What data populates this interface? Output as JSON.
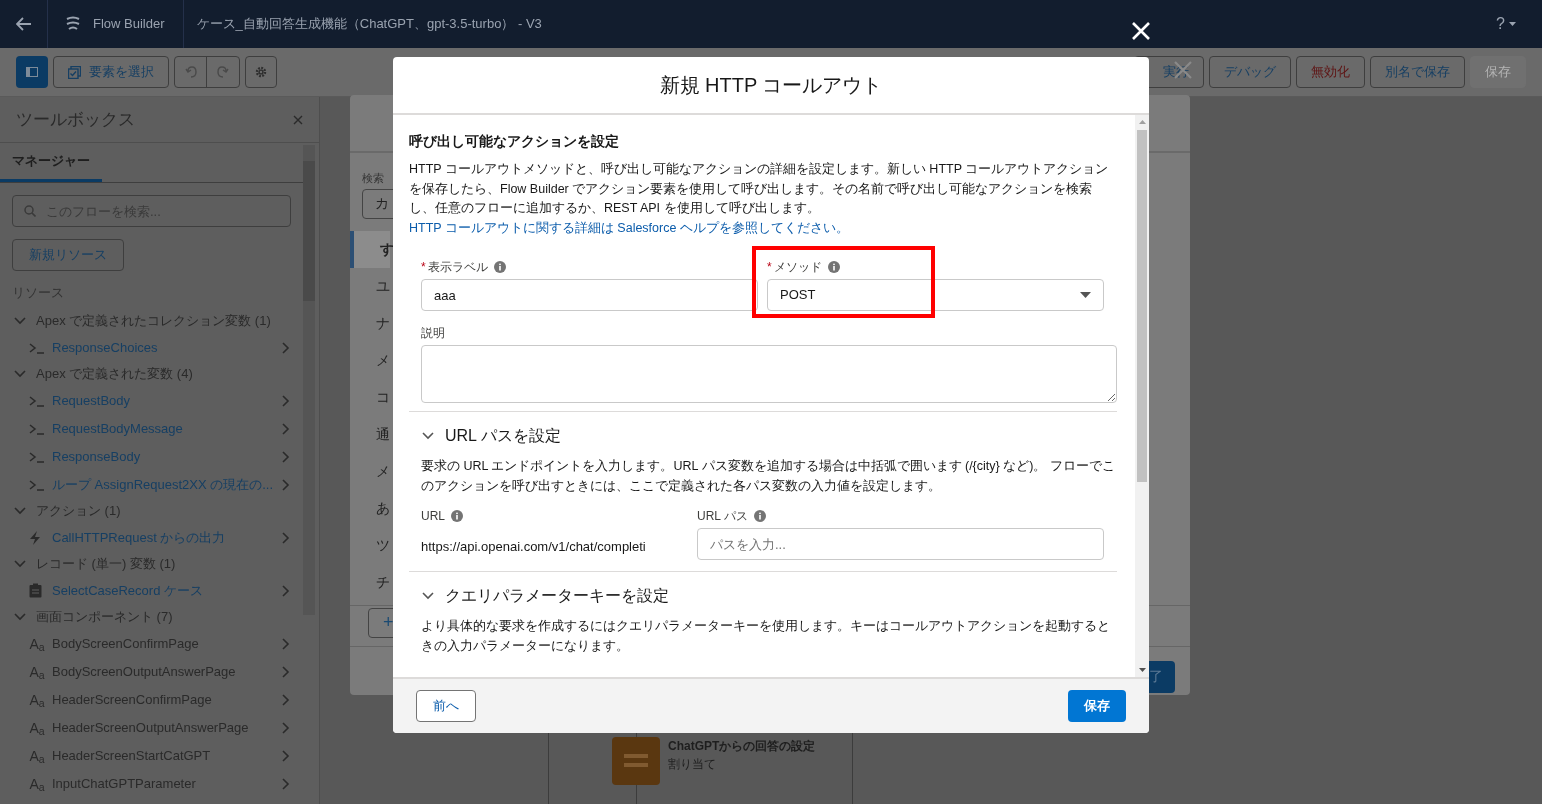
{
  "top_bar": {
    "app_name": "Flow Builder",
    "flow_title": "ケース_自動回答生成機能（ChatGPT、gpt-3.5-turbo） - V3",
    "help": "?"
  },
  "toolbar": {
    "select_button": "要素を選択",
    "right_buttons": [
      {
        "label": "実行",
        "kind": "neutral",
        "disabled": false
      },
      {
        "label": "デバッグ",
        "kind": "neutral",
        "disabled": false
      },
      {
        "label": "無効化",
        "kind": "danger",
        "disabled": false
      },
      {
        "label": "別名で保存",
        "kind": "neutral",
        "disabled": false
      },
      {
        "label": "保存",
        "kind": "neutral",
        "disabled": true
      }
    ]
  },
  "sidebar": {
    "title": "ツールボックス",
    "tabs": [
      {
        "label": "マネージャー",
        "selected": true
      }
    ],
    "search": {
      "placeholder": "このフローを検索..."
    },
    "new_resource_button": "新規リソース",
    "section_label": "リソース",
    "groups": [
      {
        "label": "Apex で定義されたコレクション変数 (1)",
        "expanded": true,
        "children": [
          {
            "label": "ResponseChoices",
            "kind": "variable"
          }
        ]
      },
      {
        "label": "Apex で定義された変数 (4)",
        "expanded": true,
        "children": [
          {
            "label": "RequestBody",
            "kind": "variable"
          },
          {
            "label": "RequestBodyMessage",
            "kind": "variable"
          },
          {
            "label": "ResponseBody",
            "kind": "variable"
          },
          {
            "label": "ループ AssignRequest2XX の現在の...",
            "kind": "variable"
          }
        ]
      },
      {
        "label": "アクション (1)",
        "expanded": true,
        "children": [
          {
            "label": "CallHTTPRequest からの出力",
            "kind": "action"
          }
        ]
      },
      {
        "label": "レコード (単一) 変数 (1)",
        "expanded": true,
        "children": [
          {
            "label": "SelectCaseRecord ケース",
            "kind": "record"
          }
        ]
      },
      {
        "label": "画面コンポーネント (7)",
        "expanded": true,
        "children": [
          {
            "label": "BodyScreenConfirmPage",
            "kind": "screen",
            "icon_text": "A$_{a}$"
          },
          {
            "label": "BodyScreenOutputAnswerPage",
            "kind": "screen",
            "icon_text": "A$_{a}$"
          },
          {
            "label": "HeaderScreenConfirmPage",
            "kind": "screen",
            "icon_text": "A$_{a}$"
          },
          {
            "label": "HeaderScreenOutputAnswerPage",
            "kind": "screen",
            "icon_text": "A$_{a}$"
          },
          {
            "label": "HeaderScreenStartCatGPT",
            "kind": "screen",
            "icon_text": "A$_{a}$"
          },
          {
            "label": "InputChatGPTParameter",
            "kind": "screen",
            "icon_text": "A$_{a}$"
          }
        ]
      }
    ]
  },
  "background_dialog": {
    "search_label": "検索",
    "search_value": "カ",
    "items": [
      {
        "label": "す",
        "selected": true
      },
      {
        "label": "ユ",
        "selected": false
      },
      {
        "label": "ナ",
        "selected": false
      },
      {
        "label": "メ",
        "selected": false
      },
      {
        "label": "コ",
        "selected": false
      },
      {
        "label": "通",
        "selected": false
      },
      {
        "label": "メ",
        "selected": false
      },
      {
        "label": "あ",
        "selected": false
      },
      {
        "label": "ツ",
        "selected": false
      },
      {
        "label": "チ",
        "selected": false
      }
    ],
    "add_button": "+",
    "done_button": "了"
  },
  "canvas_node": {
    "title": "ChatGPTからの回答の設定",
    "subtitle": "割り当て"
  },
  "modal": {
    "title": "新規 HTTP コールアウト",
    "required_mark": "*",
    "heading": "呼び出し可能なアクションを設定",
    "intro": "HTTP コールアウトメソッドと、呼び出し可能なアクションの詳細を設定します。新しい HTTP コールアウトアクションを保存したら、Flow Builder でアクション要素を使用して呼び出します。その名前で呼び出し可能なアクションを検索し、任意のフローに追加するか、REST API を使用して呼び出します。",
    "intro_link": "HTTP コールアウトに関する詳細は Salesforce ヘルプを参照してください。",
    "label_field": {
      "label": "表示ラベル",
      "required": true,
      "value": "aaa"
    },
    "method_field": {
      "label": "メソッド",
      "required": true,
      "value": "POST",
      "highlighted": true
    },
    "description_field": {
      "label": "説明"
    },
    "sections": [
      {
        "title": "URL パスを設定",
        "expanded": true,
        "description": "要求の URL エンドポイントを入力します。URL パス変数を追加する場合は中括弧で囲います (/{city} など)。 フローでこのアクションを呼び出すときには、ここで定義された各パス変数の入力値を設定します。",
        "url_label": "URL",
        "url_value": "https://api.openai.com/v1/chat/completi",
        "path_label": "URL パス",
        "path_placeholder": "パスを入力..."
      },
      {
        "title": "クエリパラメーターキーを設定",
        "expanded": true,
        "description": "より具体的な要求を作成するにはクエリパラメーターキーを使用します。キーはコールアウトアクションを起動するときの入力パラメーターになります。"
      }
    ],
    "back_button": "前へ",
    "save_button": "保存"
  }
}
